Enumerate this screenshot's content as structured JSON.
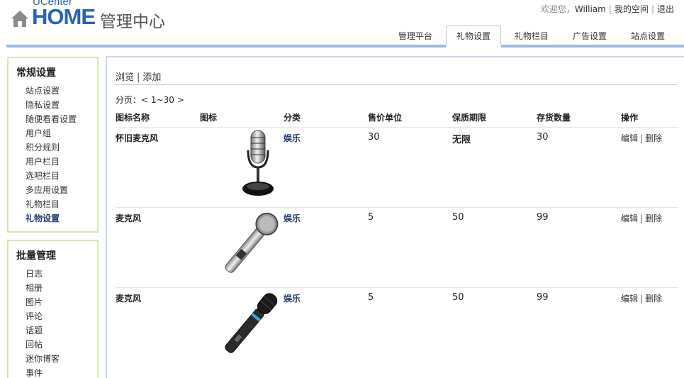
{
  "logo": {
    "top": "UCenter",
    "main": "HOME",
    "sub": "管理中心"
  },
  "userbar": {
    "welcome": "欢迎您，",
    "user": "William",
    "myspace": "我的空间",
    "logout": "退出"
  },
  "topnav": [
    {
      "label": "管理平台",
      "active": false
    },
    {
      "label": "礼物设置",
      "active": true
    },
    {
      "label": "礼物栏目",
      "active": false
    },
    {
      "label": "广告设置",
      "active": false
    },
    {
      "label": "站点设置",
      "active": false
    }
  ],
  "sidebar": {
    "general": {
      "title": "常规设置",
      "items": [
        "站点设置",
        "隐私设置",
        "随便看看设置",
        "用户组",
        "积分规则",
        "用户栏目",
        "选吧栏目",
        "多应用设置",
        "礼物栏目",
        "礼物设置"
      ],
      "active": "礼物设置"
    },
    "batch": {
      "title": "批量管理",
      "items": [
        "日志",
        "相册",
        "图片",
        "评论",
        "话题",
        "回帖",
        "迷你博客",
        "事件"
      ]
    }
  },
  "subnav": {
    "browse": "浏览",
    "add": "添加"
  },
  "pager": {
    "label": "分页：",
    "prev": "<",
    "range": "1~30",
    "next": ">"
  },
  "table": {
    "headers": [
      "图标名称",
      "图标",
      "分类",
      "售价单位",
      "保质期限",
      "存货数量",
      "操作"
    ],
    "rows": [
      {
        "name": "怀旧麦克风",
        "icon": "retro-microphone",
        "category": "娱乐",
        "price": "30",
        "shelf": "无限",
        "stock": "30",
        "edit": "编辑",
        "del": "删除"
      },
      {
        "name": "麦克风",
        "icon": "silver-microphone",
        "category": "娱乐",
        "price": "5",
        "shelf": "50",
        "stock": "99",
        "edit": "编辑",
        "del": "删除"
      },
      {
        "name": "麦克风",
        "icon": "black-microphone",
        "category": "娱乐",
        "price": "5",
        "shelf": "50",
        "stock": "99",
        "edit": "编辑",
        "del": "删除"
      }
    ]
  },
  "colors": {
    "brand": "#2b63b3",
    "navline": "#9fb9e6",
    "sidebox_border": "#d5e7b0",
    "link_dark": "#2a3d70"
  }
}
